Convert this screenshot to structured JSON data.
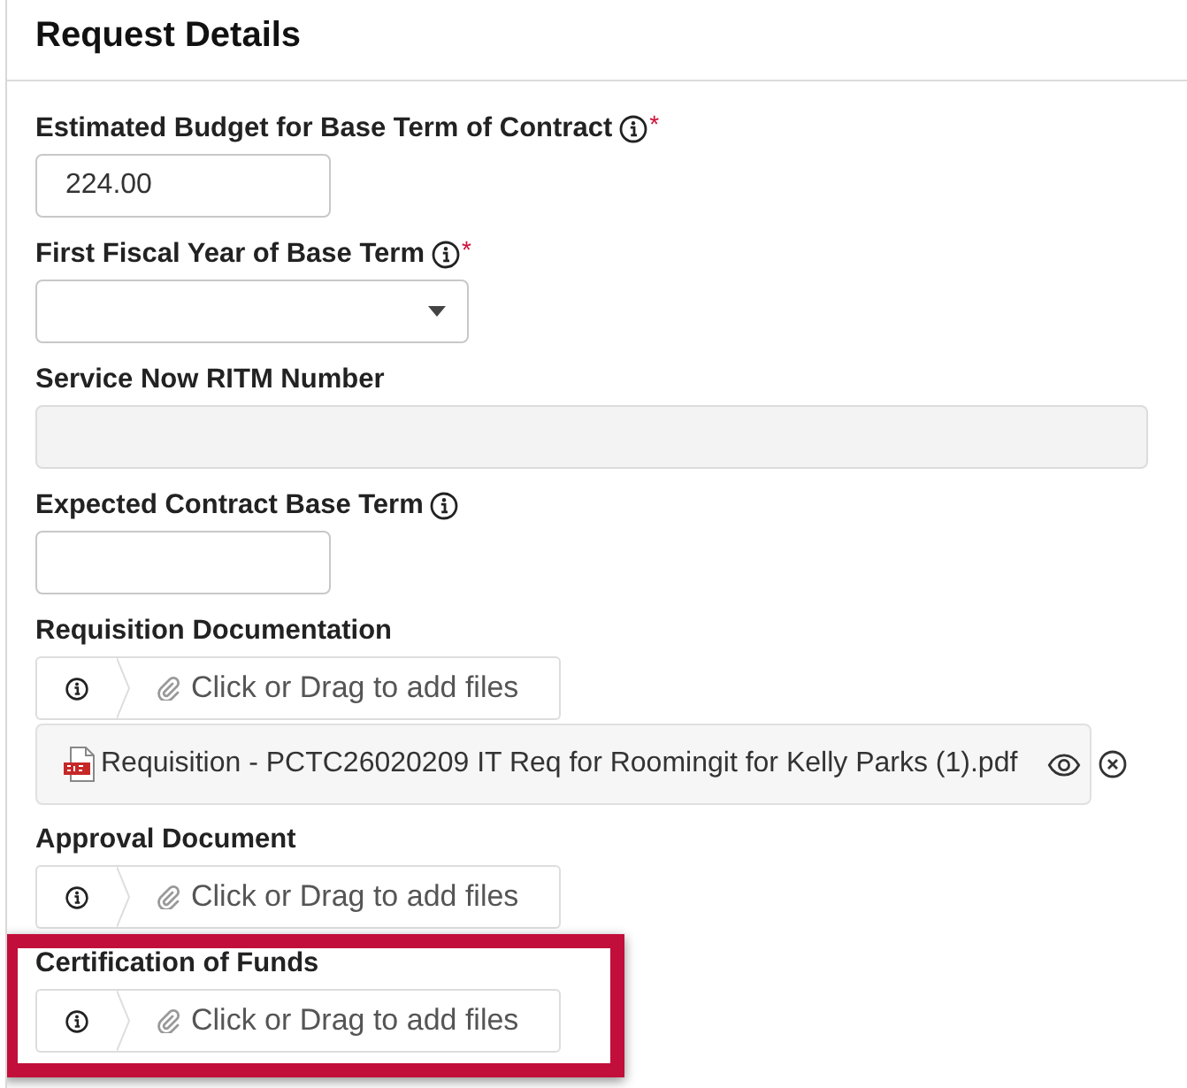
{
  "header": {
    "title": "Request Details"
  },
  "fields": [
    {
      "kind": "number",
      "label": "Estimated Budget for Base Term of Contract",
      "info": true,
      "required_mark": "*",
      "value": "224.00",
      "disabled": false,
      "highlighted": false
    },
    {
      "kind": "select",
      "label": "First Fiscal Year of Base Term",
      "info": true,
      "required_mark": "*",
      "highlighted": false
    },
    {
      "kind": "text",
      "label": "Service Now RITM Number",
      "info": false,
      "disabled": true,
      "highlighted": false
    },
    {
      "kind": "number",
      "label": "Expected Contract Base Term",
      "info": true,
      "disabled": false,
      "highlighted": false
    },
    {
      "kind": "file",
      "label": "Requisition Documentation",
      "info": false,
      "prompt": "Click or Drag to add files",
      "files": [
        {
          "name": "Requisition - PCTC26020209 IT Req for Roomingit for Kelly Parks (1).pdf"
        }
      ],
      "highlighted": false
    },
    {
      "kind": "file",
      "label": "Approval Document",
      "info": false,
      "prompt": "Click or Drag to add files",
      "highlighted": false
    },
    {
      "kind": "file",
      "label": "Certification of Funds",
      "info": false,
      "prompt": "Click or Drag to add files",
      "highlighted": true
    }
  ]
}
